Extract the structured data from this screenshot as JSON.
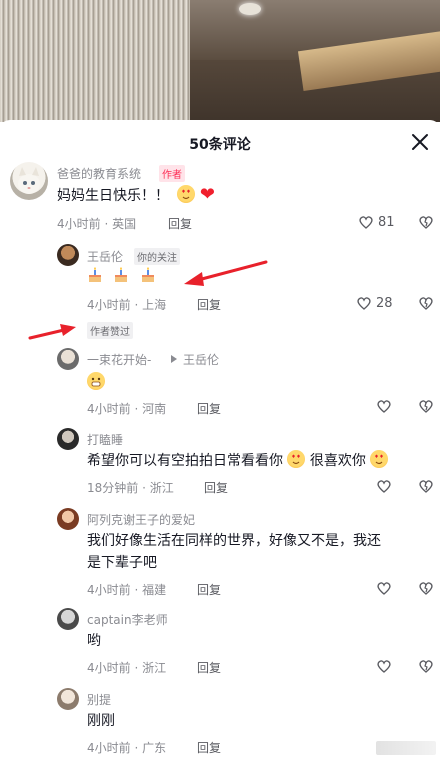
{
  "header": {
    "title": "50条评论"
  },
  "comments": [
    {
      "user": "爸爸的教育系统",
      "badge": "作者",
      "text": "妈妈生日快乐！！",
      "meta": "4小时前 · 英国",
      "reply": "回复",
      "likes": "81"
    },
    {
      "user": "王岳伦",
      "badge": "你的关注",
      "text": "",
      "meta": "4小时前 · 上海",
      "reply": "回复",
      "likes": "28",
      "sub_badge": "作者赞过"
    },
    {
      "user": "一束花开始-",
      "reply_to": "王岳伦",
      "text": "",
      "meta": "4小时前 · 河南",
      "reply": "回复"
    },
    {
      "user": "打瞌睡",
      "text_a": "希望你可以有空拍拍日常看看你",
      "text_b": "很喜欢你",
      "meta": "18分钟前 · 浙江",
      "reply": "回复"
    },
    {
      "user": "阿列克谢王子的爱妃",
      "text_line1": "我们好像生活在同样的世界，好像又不是，我还",
      "text_line2": "是下辈子吧",
      "meta": "4小时前 · 福建",
      "reply": "回复"
    },
    {
      "user": "captain李老师",
      "text": "哟",
      "meta": "4小时前 · 浙江",
      "reply": "回复"
    },
    {
      "user": "别提",
      "text": "刚刚",
      "meta": "4小时前 · 广东",
      "reply": "回复"
    }
  ],
  "icons": {
    "close": "close-icon",
    "like": "heart-outline-icon",
    "dislike": "broken-heart-icon",
    "arrow": "red-arrow-annotation"
  },
  "colors": {
    "accent": "#fe2c55",
    "arrow": "#e8212b"
  }
}
